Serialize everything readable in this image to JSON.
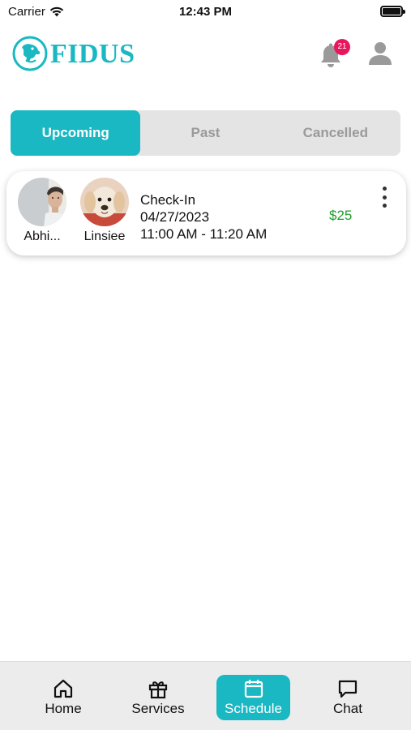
{
  "status_bar": {
    "carrier": "Carrier",
    "time": "12:43 PM",
    "icons": [
      "wifi-icon",
      "battery-icon"
    ]
  },
  "header": {
    "logo_text": "FIDUS",
    "notification_count": "21",
    "icons": [
      "dog-logo-icon",
      "bell-icon",
      "user-icon"
    ]
  },
  "tabs": [
    {
      "label": "Upcoming",
      "active": true
    },
    {
      "label": "Past",
      "active": false
    },
    {
      "label": "Cancelled",
      "active": false
    }
  ],
  "appointments": [
    {
      "owner_name": "Abhi...",
      "pet_name": "Linsiee",
      "service": "Check-In",
      "date": "04/27/2023",
      "time_range": "11:00 AM - 11:20 AM",
      "price": "$25"
    }
  ],
  "bottom_nav": [
    {
      "label": "Home",
      "icon": "home-icon",
      "active": false
    },
    {
      "label": "Services",
      "icon": "gift-icon",
      "active": false
    },
    {
      "label": "Schedule",
      "icon": "calendar-icon",
      "active": true
    },
    {
      "label": "Chat",
      "icon": "chat-icon",
      "active": false
    }
  ],
  "colors": {
    "brand": "#19b8c2",
    "badge": "#e8175d",
    "price": "#1f9d2c",
    "tab_inactive_bg": "#e4e4e4"
  }
}
